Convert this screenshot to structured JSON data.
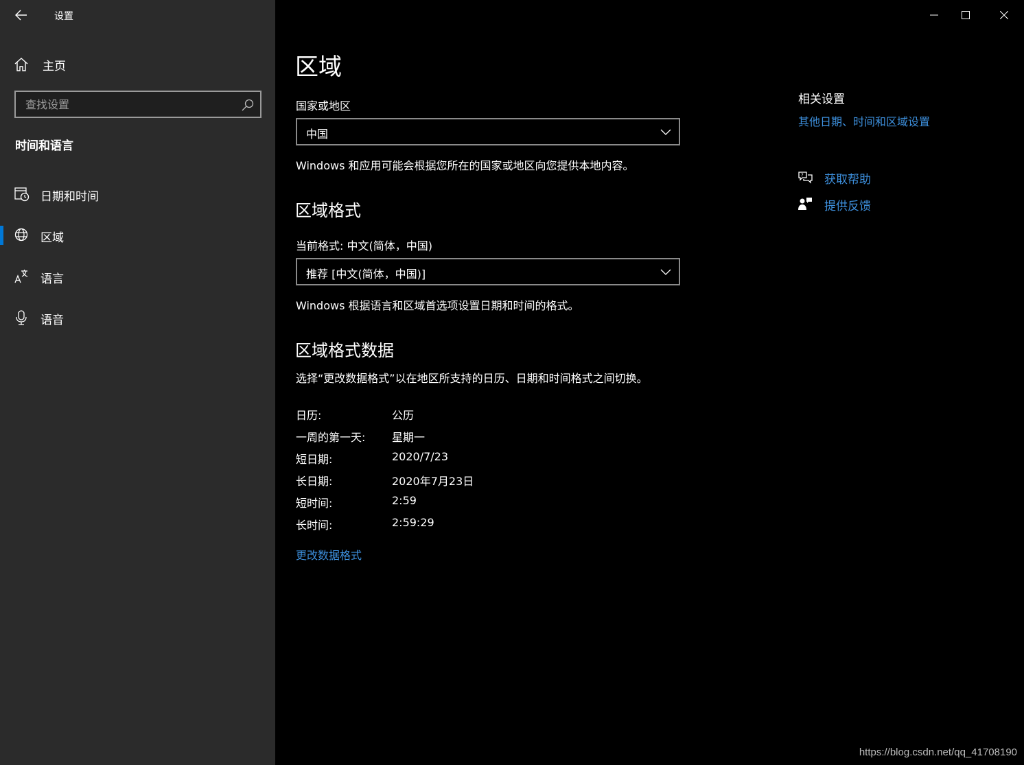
{
  "window": {
    "title": "设置",
    "controls": {
      "minimize": "minimize",
      "maximize": "maximize",
      "close": "close"
    }
  },
  "sidebar": {
    "home_label": "主页",
    "search_placeholder": "查找设置",
    "section_title": "时间和语言",
    "items": [
      {
        "label": "日期和时间",
        "icon": "calendar-clock-icon",
        "active": false
      },
      {
        "label": "区域",
        "icon": "globe-icon",
        "active": true
      },
      {
        "label": "语言",
        "icon": "language-icon",
        "active": false
      },
      {
        "label": "语音",
        "icon": "microphone-icon",
        "active": false
      }
    ]
  },
  "main": {
    "title": "区域",
    "country": {
      "label": "国家或地区",
      "value": "中国",
      "description": "Windows 和应用可能会根据您所在的国家或地区向您提供本地内容。"
    },
    "format": {
      "heading": "区域格式",
      "current_label": "当前格式: 中文(简体，中国)",
      "value": "推荐 [中文(简体，中国)]",
      "description": "Windows 根据语言和区域首选项设置日期和时间的格式。"
    },
    "format_data": {
      "heading": "区域格式数据",
      "description": "选择“更改数据格式”以在地区所支持的日历、日期和时间格式之间切换。",
      "rows": [
        {
          "key": "日历:",
          "value": "公历"
        },
        {
          "key": "一周的第一天:",
          "value": "星期一"
        },
        {
          "key": "短日期:",
          "value": "2020/7/23"
        },
        {
          "key": "长日期:",
          "value": "2020年7月23日"
        },
        {
          "key": "短时间:",
          "value": "2:59"
        },
        {
          "key": "长时间:",
          "value": "2:59:29"
        }
      ],
      "change_link": "更改数据格式"
    }
  },
  "related": {
    "title": "相关设置",
    "link": "其他日期、时间和区域设置",
    "help_label": "获取帮助",
    "feedback_label": "提供反馈"
  },
  "watermark": "https://blog.csdn.net/qq_41708190",
  "colors": {
    "accent": "#0078d7",
    "link": "#3d8fdc",
    "sidebar_bg": "#2b2b2b",
    "main_bg": "#000000"
  }
}
